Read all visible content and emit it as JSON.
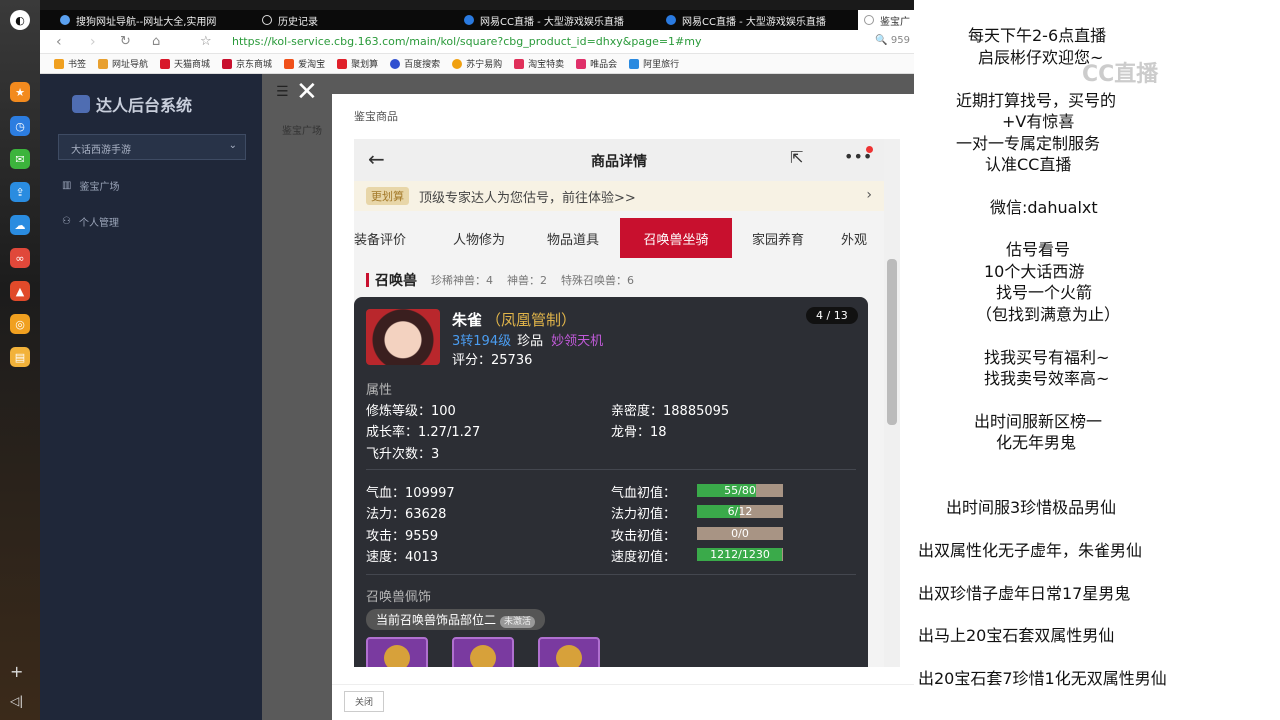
{
  "browser": {
    "tabs": [
      {
        "label": "搜狗网址导航--网址大全,实用网",
        "active": false
      },
      {
        "label": "历史记录",
        "active": false
      },
      {
        "label": "网易CC直播 - 大型游戏娱乐直播",
        "active": false
      },
      {
        "label": "网易CC直播 - 大型游戏娱乐直播",
        "active": false
      },
      {
        "label": "鉴宝广",
        "active": true
      }
    ],
    "url": "https://kol-service.cbg.163.com/main/kol/square?cbg_product_id=dhxy&page=1#my",
    "addr_right": "959",
    "bookmarks": [
      "书签",
      "网址导航",
      "天猫商城",
      "京东商城",
      "爱淘宝",
      "聚划算",
      "百度搜索",
      "苏宁易购",
      "淘宝特卖",
      "唯品会",
      "阿里旅行"
    ]
  },
  "app": {
    "brand": "达人后台系统",
    "game_select": "大话西游手游",
    "menu": [
      "鉴宝广场",
      "个人管理"
    ],
    "breadcrumb": "鉴宝广场"
  },
  "modal": {
    "title": "鉴宝商品",
    "close_label": "关闭"
  },
  "phone": {
    "title": "商品详情",
    "ad_badge": "更划算",
    "ad_text": "顶级专家达人为您估号，前往体验>>",
    "tabs": [
      "装备评价",
      "人物修为",
      "物品道具",
      "召唤兽坐骑",
      "家园养育",
      "外观"
    ],
    "active_tab": 3,
    "summary_title": "召唤兽",
    "summary": [
      "珍稀神兽：4",
      "神兽：2",
      "特殊召唤兽：6"
    ],
    "pet": {
      "name": "朱雀",
      "clan": "（凤凰管制）",
      "level": "3转194级",
      "rarity": "珍品",
      "skill": "妙领天机",
      "score": "评分：25736",
      "counter": "4 / 13"
    },
    "attr_section": "属性",
    "attrs": {
      "cultivate": "修炼等级：100",
      "intimacy": "亲密度：18885095",
      "growth": "成长率：1.27/1.27",
      "dragon": "龙骨：18",
      "ascend": "飞升次数：3"
    },
    "stats": {
      "hp": "气血：109997",
      "mp": "法力：63628",
      "atk": "攻击：9559",
      "spd": "速度：4013",
      "hp_init_label": "气血初值：",
      "mp_init_label": "法力初值：",
      "atk_init_label": "攻击初值：",
      "spd_init_label": "速度初值："
    },
    "init_values": [
      {
        "text": "55/80",
        "fraction": 0.69
      },
      {
        "text": "6/12",
        "fraction": 0.5
      },
      {
        "text": "0/0",
        "fraction": 0
      },
      {
        "text": "1212/1230",
        "fraction": 0.985
      }
    ],
    "deco_section": "召唤兽佩饰",
    "deco_label": "当前召唤兽饰品部位二",
    "deco_tag": "未激活"
  },
  "right_panel": {
    "watermark": "CC直播",
    "lines": [
      "每天下午2-6点直播",
      "启辰彬仔欢迎您~",
      "近期打算找号，买号的",
      "+V有惊喜",
      "一对一专属定制服务",
      "认准CC直播",
      "微信:dahualxt",
      "估号看号",
      "10个大话西游",
      "找号一个火箭",
      "（包找到满意为止）",
      "找我买号有福利~",
      "找我卖号效率高~",
      "出时间服新区榜一",
      "化无年男鬼",
      "出时间服3珍惜极品男仙",
      "出双属性化无子虚年，朱雀男仙",
      "出双珍惜子虚年日常17星男鬼",
      "出马上20宝石套双属性男仙",
      "出20宝石套7珍惜1化无双属性男仙"
    ]
  }
}
